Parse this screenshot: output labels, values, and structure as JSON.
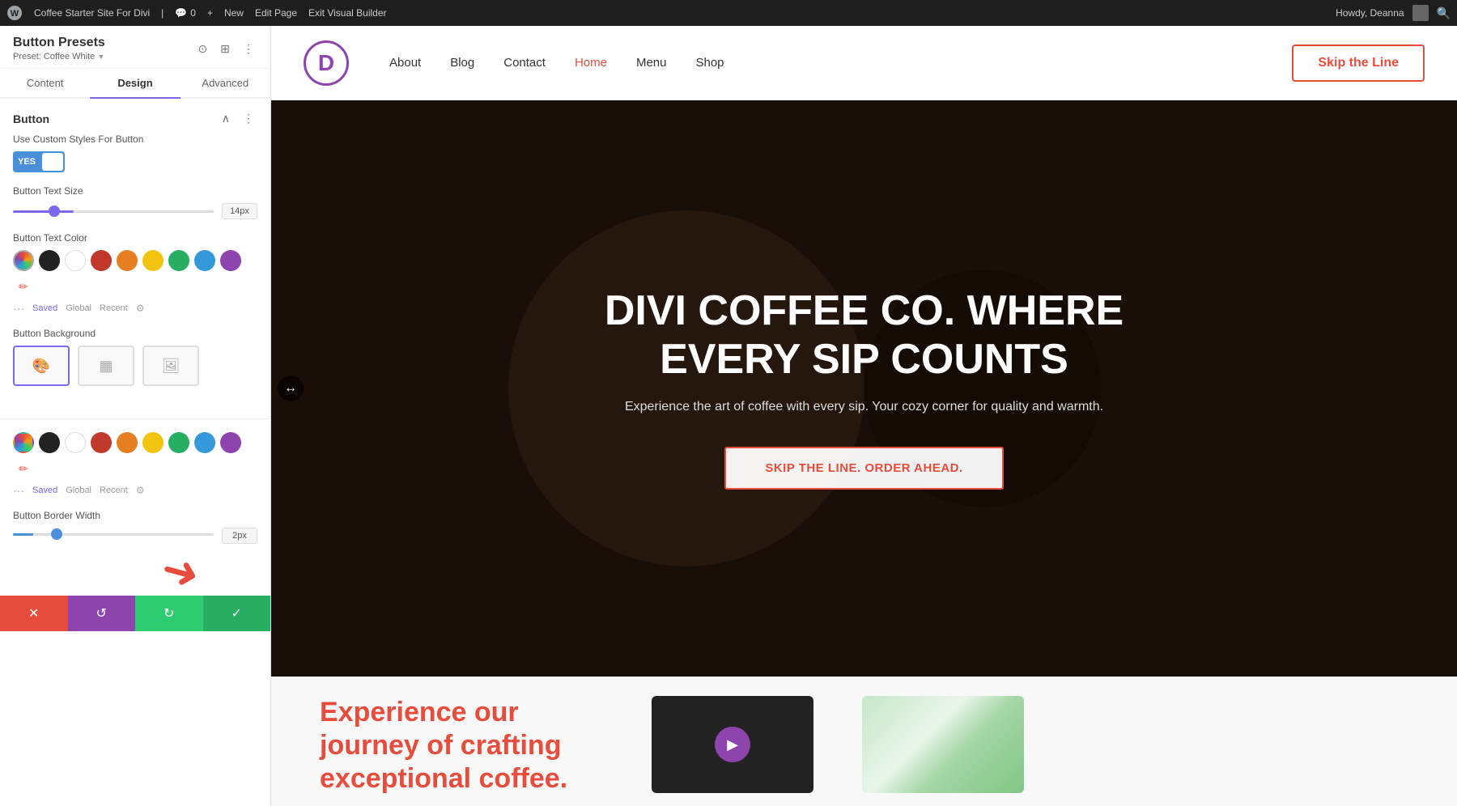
{
  "admin_bar": {
    "wp_icon": "wordpress-icon",
    "site_name": "Coffee Starter Site For Divi",
    "comments_label": "0",
    "new_label": "New",
    "edit_page_label": "Edit Page",
    "exit_builder_label": "Exit Visual Builder",
    "howdy_label": "Howdy, Deanna",
    "search_icon": "search-icon"
  },
  "panel": {
    "title": "Button Presets",
    "preset_label": "Preset: Coffee White",
    "tabs": [
      {
        "id": "content",
        "label": "Content"
      },
      {
        "id": "design",
        "label": "Design"
      },
      {
        "id": "advanced",
        "label": "Advanced"
      }
    ],
    "section_title": "Button",
    "custom_styles_label": "Use Custom Styles For Button",
    "toggle_yes": "YES",
    "button_text_size_label": "Button Text Size",
    "button_text_size_value": "14px",
    "button_text_color_label": "Button Text Color",
    "button_bg_label": "Button Background",
    "button_border_width_label": "Button Border Width",
    "button_border_width_value": "2px",
    "color_saved_label": "Saved",
    "color_global_label": "Global",
    "color_recent_label": "Recent",
    "bottom_bar": {
      "cancel_label": "✕",
      "undo_label": "↺",
      "redo_label": "↻",
      "save_label": "✓"
    }
  },
  "site_nav": {
    "logo_letter": "D",
    "links": [
      {
        "label": "About",
        "active": false
      },
      {
        "label": "Blog",
        "active": false
      },
      {
        "label": "Contact",
        "active": false
      },
      {
        "label": "Home",
        "active": true
      },
      {
        "label": "Menu",
        "active": false
      },
      {
        "label": "Shop",
        "active": false
      }
    ],
    "cta_label": "Skip the Line"
  },
  "hero": {
    "title": "DIVI COFFEE CO. WHERE EVERY SIP COUNTS",
    "subtitle": "Experience the art of coffee with every sip. Your cozy corner for quality and warmth.",
    "cta_label": "Skip The Line. Order Ahead."
  },
  "bottom_section": {
    "heading": "Experience our journey of crafting exceptional coffee."
  },
  "colors": {
    "swatches": [
      {
        "color": "#e74c3c",
        "label": "red"
      },
      {
        "color": "#222222",
        "label": "black"
      },
      {
        "color": "#ffffff",
        "label": "white"
      },
      {
        "color": "#c0392b",
        "label": "dark-red"
      },
      {
        "color": "#e67e22",
        "label": "orange"
      },
      {
        "color": "#f1c40f",
        "label": "yellow"
      },
      {
        "color": "#27ae60",
        "label": "green"
      },
      {
        "color": "#3498db",
        "label": "blue"
      },
      {
        "color": "#8e44ad",
        "label": "purple"
      }
    ],
    "swatches2": [
      {
        "color": "#222222",
        "label": "black"
      },
      {
        "color": "#ffffff",
        "label": "white"
      },
      {
        "color": "#c0392b",
        "label": "dark-red"
      },
      {
        "color": "#e67e22",
        "label": "orange"
      },
      {
        "color": "#f1c40f",
        "label": "yellow"
      },
      {
        "color": "#27ae60",
        "label": "green"
      },
      {
        "color": "#3498db",
        "label": "blue"
      },
      {
        "color": "#8e44ad",
        "label": "purple"
      }
    ]
  }
}
